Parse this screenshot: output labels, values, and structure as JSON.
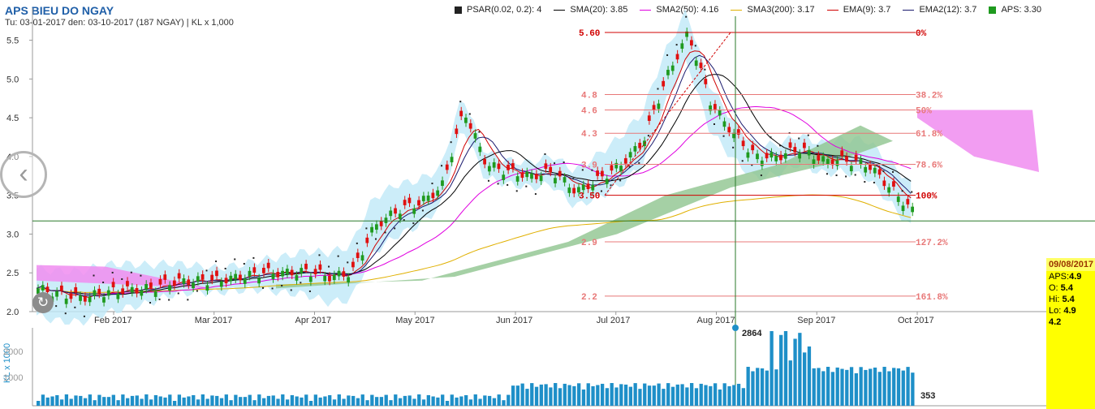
{
  "header": {
    "title": "APS BIEU DO NGAY",
    "subtitle": "Tu: 03-01-2017 den: 03-10-2017 (187 NGAY) | KL x 1,000"
  },
  "legend": [
    {
      "label": "PSAR(0.02, 0.2): 4",
      "kind": "box",
      "color": "#222222"
    },
    {
      "label": "SMA(20): 3.85",
      "kind": "line",
      "color": "#000000"
    },
    {
      "label": "SMA2(50): 4.16",
      "kind": "line",
      "color": "#e000e0"
    },
    {
      "label": "SMA3(200): 3.17",
      "kind": "line",
      "color": "#e0b000"
    },
    {
      "label": "EMA(9): 3.7",
      "kind": "line",
      "color": "#d00000"
    },
    {
      "label": "EMA2(12): 3.7",
      "kind": "line",
      "color": "#1a1a6e"
    },
    {
      "label": "APS: 3.30",
      "kind": "box",
      "color": "#1f9a1f"
    }
  ],
  "tooltip": {
    "date": "09/08/2017",
    "rows": [
      {
        "label": "APS:",
        "value": "4.9"
      },
      {
        "label": "O: ",
        "value": "5.4"
      },
      {
        "label": "Hi: ",
        "value": "5.4"
      },
      {
        "label": "Lo: ",
        "value": "4.9"
      },
      {
        "label": "",
        "value": "4.2"
      }
    ]
  },
  "colors": {
    "up": "#1f9a1f",
    "down": "#e01010",
    "volume": "#1e8fc8",
    "cloud_top": "#bfe9f7",
    "cloud_green": "#8fc48f",
    "cloud_pink": "#f08cf0",
    "crosshair": "#2a7a2a",
    "fib": "#e87878"
  },
  "chart_data": {
    "type": "candlestick",
    "title": "APS BIEU DO NGAY",
    "ylim": [
      2.0,
      5.6
    ],
    "y_ticks": [
      "2.0",
      "2.5",
      "3.0",
      "3.5",
      "4.0",
      "4.5",
      "5.0",
      "5.5"
    ],
    "x_ticks": [
      "Feb 2017",
      "Mar 2017",
      "Apr 2017",
      "May 2017",
      "Jun 2017",
      "Jul 2017",
      "Aug 2017",
      "Sep 2017",
      "Oct 2017"
    ],
    "volume_ylabel": "KL x 1000",
    "volume_ticks": [
      "2000",
      "1000"
    ],
    "volume_peak_label": "2864",
    "volume_last_label": "353",
    "crosshair_price": 3.17,
    "price_path": [
      [
        2.3,
        2.3
      ],
      [
        2.2,
        2.22
      ],
      [
        2.15,
        2.18
      ],
      [
        2.2,
        2.25
      ],
      [
        2.25,
        2.28
      ],
      [
        2.3,
        2.3
      ],
      [
        2.35,
        2.38
      ],
      [
        2.38,
        2.4
      ],
      [
        2.4,
        2.4
      ],
      [
        2.42,
        2.45
      ],
      [
        2.45,
        2.5
      ],
      [
        2.48,
        2.5
      ],
      [
        2.5,
        2.52
      ],
      [
        2.4,
        2.45
      ],
      [
        2.45,
        2.5
      ],
      [
        2.9,
        3.1
      ],
      [
        3.15,
        3.3
      ],
      [
        3.35,
        3.4
      ],
      [
        3.5,
        3.6
      ],
      [
        4.2,
        4.6
      ],
      [
        4.0,
        3.9
      ],
      [
        3.75,
        3.8
      ],
      [
        3.7,
        3.75
      ],
      [
        3.9,
        3.8
      ],
      [
        3.6,
        3.55
      ],
      [
        3.6,
        3.7
      ],
      [
        3.8,
        3.9
      ],
      [
        4.0,
        4.2
      ],
      [
        4.6,
        5.0
      ],
      [
        5.4,
        5.6
      ],
      [
        4.8,
        4.7
      ],
      [
        4.4,
        4.3
      ],
      [
        4.1,
        4.0
      ],
      [
        3.95,
        4.0
      ],
      [
        4.2,
        4.1
      ],
      [
        4.0,
        3.95
      ],
      [
        3.9,
        3.95
      ],
      [
        4.0,
        3.9
      ],
      [
        3.7,
        3.6
      ],
      [
        3.3,
        3.3
      ]
    ],
    "fibonacci": {
      "high": 5.6,
      "low": 3.5,
      "levels": [
        {
          "ratio": "0%",
          "price": "5.60"
        },
        {
          "ratio": "38.2%",
          "price": "4.8"
        },
        {
          "ratio": "50%",
          "price": "4.6"
        },
        {
          "ratio": "61.8%",
          "price": "4.3"
        },
        {
          "ratio": "78.6%",
          "price": "3.9"
        },
        {
          "ratio": "100%",
          "price": "3.50"
        },
        {
          "ratio": "127.2%",
          "price": "2.9"
        },
        {
          "ratio": "161.8%",
          "price": "2.2"
        }
      ]
    },
    "series": [
      {
        "name": "SMA(20)",
        "last": 3.85
      },
      {
        "name": "SMA2(50)",
        "last": 4.16
      },
      {
        "name": "SMA3(200)",
        "last": 3.17
      },
      {
        "name": "EMA(9)",
        "last": 3.7
      },
      {
        "name": "EMA2(12)",
        "last": 3.7
      },
      {
        "name": "PSAR(0.02, 0.2)",
        "last": 4
      },
      {
        "name": "APS",
        "last": 3.3
      }
    ]
  }
}
